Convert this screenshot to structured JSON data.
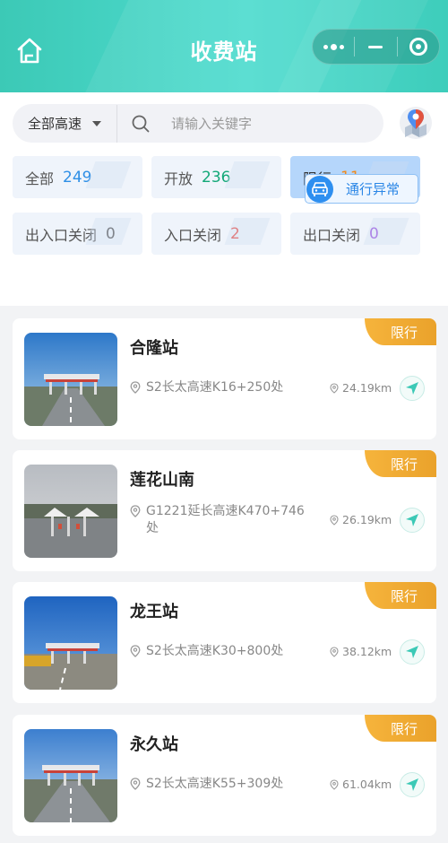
{
  "header": {
    "title": "收费站"
  },
  "filter": {
    "highway_select": "全部高速",
    "search_placeholder": "请输入关键字"
  },
  "stats": [
    {
      "label": "全部",
      "value": "249",
      "color": "#2e8fe6"
    },
    {
      "label": "开放",
      "value": "236",
      "color": "#13a878"
    },
    {
      "label": "限行",
      "value": "11",
      "color": "#f08a1c"
    },
    {
      "label": "出入口关闭",
      "value": "0",
      "color": "#555555"
    },
    {
      "label": "入口关闭",
      "value": "2",
      "color": "#e8504a"
    },
    {
      "label": "出口关闭",
      "value": "0",
      "color": "#9a55e0"
    }
  ],
  "abnormal_button": "通行异常",
  "stations": [
    {
      "name": "合隆站",
      "location": "S2长太高速K16+250处",
      "distance": "24.19km",
      "status": "限行"
    },
    {
      "name": "莲花山南",
      "location": "G1221延长高速K470+746处",
      "distance": "26.19km",
      "status": "限行"
    },
    {
      "name": "龙王站",
      "location": "S2长太高速K30+800处",
      "distance": "38.12km",
      "status": "限行"
    },
    {
      "name": "永久站",
      "location": "S2长太高速K55+309处",
      "distance": "61.04km",
      "status": "限行"
    }
  ],
  "colors": {
    "header_start": "#3cc9b6",
    "header_end": "#4fdccf",
    "tag_orange": "#eea52d",
    "active_card": "#b5d6fb",
    "accent_blue": "#2e8ff0"
  }
}
